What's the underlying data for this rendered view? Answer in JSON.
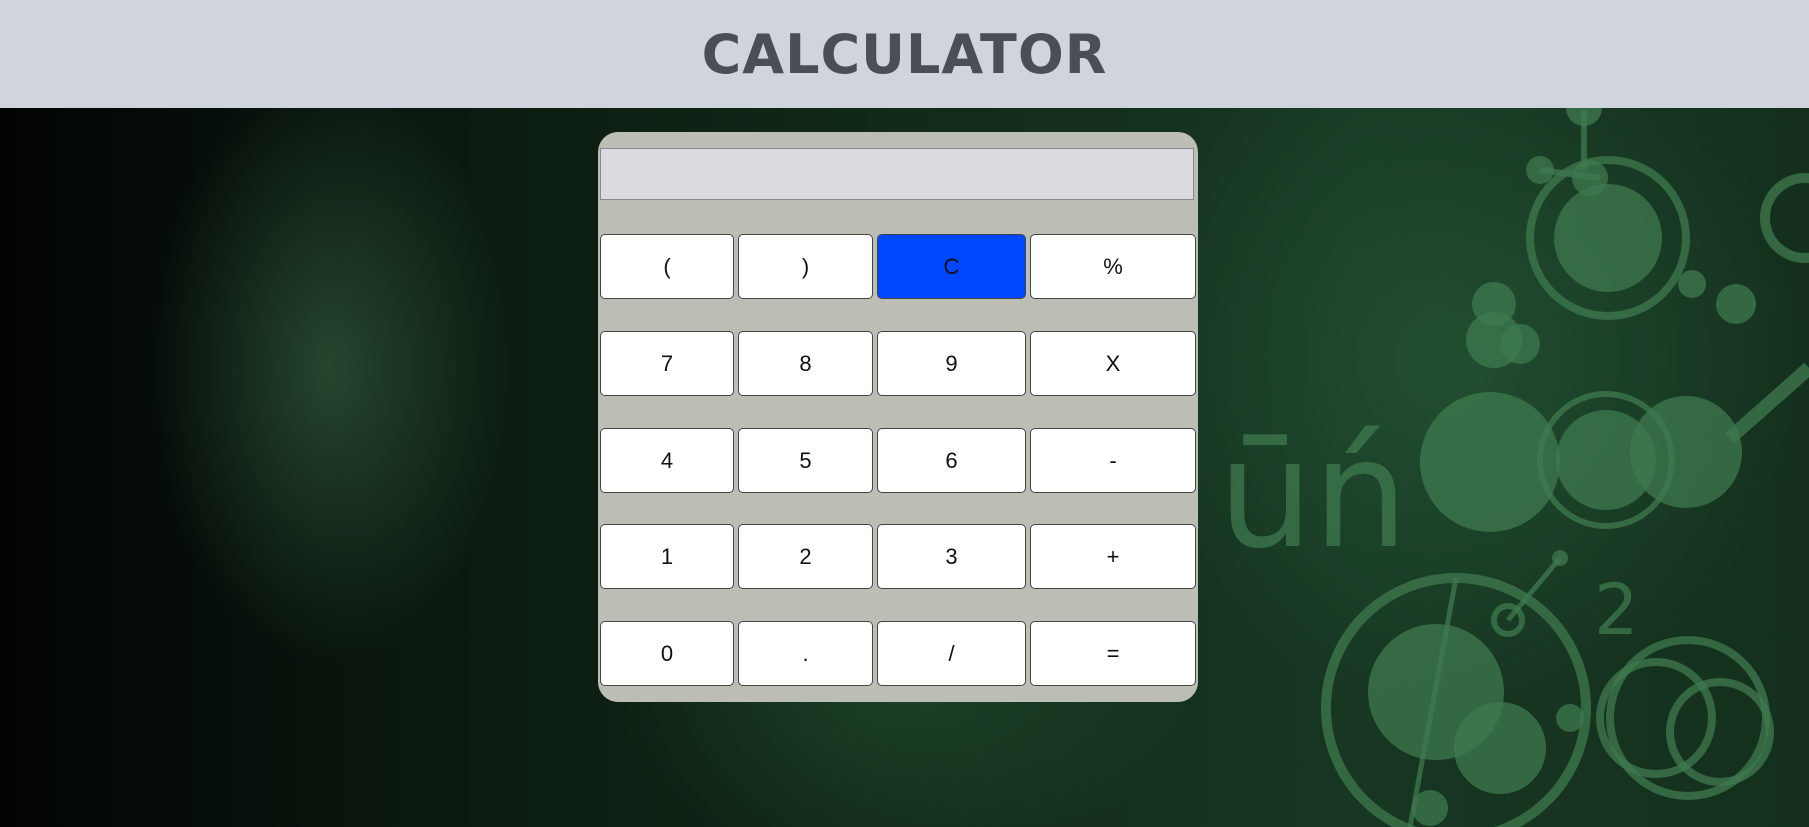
{
  "header": {
    "title": "CALCULATOR"
  },
  "display": {
    "value": ""
  },
  "keys": {
    "open_paren": "(",
    "close_paren": ")",
    "clear": "C",
    "percent": "%",
    "seven": "7",
    "eight": "8",
    "nine": "9",
    "multiply": "X",
    "four": "4",
    "five": "5",
    "six": "6",
    "minus": "-",
    "one": "1",
    "two": "2",
    "three": "3",
    "plus": "+",
    "zero": "0",
    "decimal": ".",
    "divide": "/",
    "equals": "="
  },
  "colors": {
    "header_bg": "#cfd4dd",
    "title": "#4a4e55",
    "calculator_bg": "#bcbdb5",
    "display_bg": "#dadae0",
    "clear_key": "#0048ff",
    "key_bg": "#ffffff"
  },
  "background": {
    "decoration_text": "ūń",
    "decoration_number": "2"
  }
}
